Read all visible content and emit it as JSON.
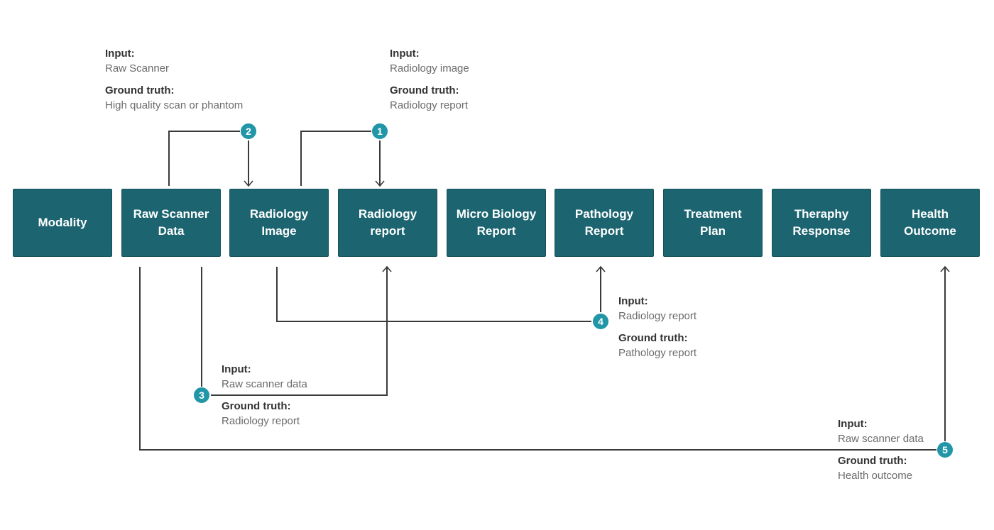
{
  "diagram": {
    "colors": {
      "box_fill": "#1b6470",
      "badge_fill": "#2196a6",
      "line": "#3a3a3a",
      "label": "#333333",
      "value": "#6b6b6b"
    },
    "stages": [
      {
        "id": "modality",
        "label": "Modality"
      },
      {
        "id": "raw-scanner-data",
        "label": "Raw Scanner\nData"
      },
      {
        "id": "radiology-image",
        "label": "Radiology\nImage"
      },
      {
        "id": "radiology-report",
        "label": "Radiology\nreport"
      },
      {
        "id": "micro-biology-report",
        "label": "Micro Biology\nReport"
      },
      {
        "id": "pathology-report",
        "label": "Pathology\nReport"
      },
      {
        "id": "treatment-plan",
        "label": "Treatment\nPlan"
      },
      {
        "id": "theraphy-response",
        "label": "Theraphy\nResponse"
      },
      {
        "id": "health-outcome",
        "label": "Health\nOutcome"
      }
    ],
    "tasks": [
      {
        "number": "1",
        "from": "radiology-image",
        "to": "radiology-report",
        "input_label": "Input:",
        "input_value": "Radiology image",
        "truth_label": "Ground truth:",
        "truth_value": "Radiology report"
      },
      {
        "number": "2",
        "from": "raw-scanner-data",
        "to": "radiology-image",
        "input_label": "Input:",
        "input_value": "Raw Scanner",
        "truth_label": "Ground truth:",
        "truth_value": "High quality scan or phantom"
      },
      {
        "number": "3",
        "from": "raw-scanner-data",
        "to": "radiology-report",
        "input_label": "Input:",
        "input_value": "Raw scanner data",
        "truth_label": "Ground truth:",
        "truth_value": "Radiology report"
      },
      {
        "number": "4",
        "from": "radiology-image",
        "to": "pathology-report",
        "input_label": "Input:",
        "input_value": "Radiology report",
        "truth_label": "Ground truth:",
        "truth_value": "Pathology report"
      },
      {
        "number": "5",
        "from": "raw-scanner-data",
        "to": "health-outcome",
        "input_label": "Input:",
        "input_value": "Raw scanner data",
        "truth_label": "Ground truth:",
        "truth_value": "Health outcome"
      }
    ]
  }
}
